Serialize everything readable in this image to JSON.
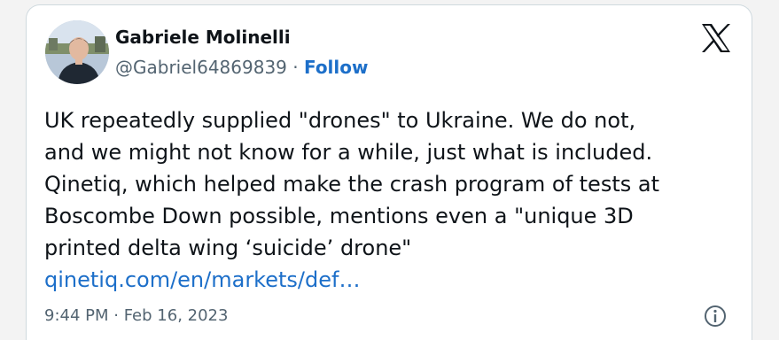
{
  "author": {
    "name": "Gabriele Molinelli",
    "handle": "@Gabriel64869839",
    "separator": "·",
    "follow_label": "Follow"
  },
  "tweet": {
    "lines": [
      "UK repeatedly supplied \"drones\" to Ukraine. We do not,",
      "and we might not know for a while, just what is included.",
      "Qinetiq, which helped make the crash program of tests at",
      "Boscombe Down possible, mentions even a \"unique 3D",
      "printed delta wing ‘suicide’ drone\""
    ],
    "link_text": "qinetiq.com/en/markets/def…"
  },
  "meta": {
    "timestamp": "9:44 PM · Feb 16, 2023"
  },
  "icons": {
    "brand": "x-logo-icon",
    "info": "info-icon"
  },
  "colors": {
    "link": "#1d6fc9",
    "text": "#0f1419",
    "muted": "#536471"
  }
}
